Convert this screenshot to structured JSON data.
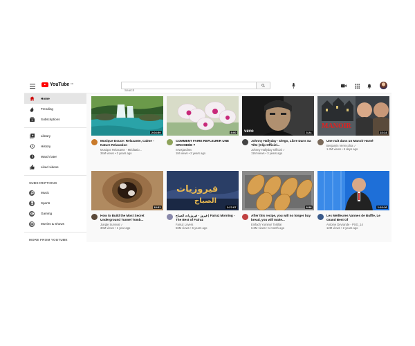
{
  "header": {
    "logo_text": "YouTube",
    "logo_region": "FR",
    "search_placeholder": "Search"
  },
  "sidebar": {
    "main": [
      {
        "label": "Home",
        "icon": "home-icon",
        "active": true
      },
      {
        "label": "Trending",
        "icon": "trending-icon"
      },
      {
        "label": "Subscriptions",
        "icon": "subscriptions-icon"
      }
    ],
    "library": [
      {
        "label": "Library",
        "icon": "library-icon"
      },
      {
        "label": "History",
        "icon": "history-icon"
      },
      {
        "label": "Watch later",
        "icon": "watch-later-icon"
      },
      {
        "label": "Liked videos",
        "icon": "like-icon"
      }
    ],
    "subscriptions_heading": "SUBSCRIPTIONS",
    "subscriptions": [
      {
        "label": "Music",
        "icon": "music-icon"
      },
      {
        "label": "Sports",
        "icon": "trophy-icon"
      },
      {
        "label": "Gaming",
        "icon": "gamepad-icon"
      },
      {
        "label": "Movies & Shows",
        "icon": "film-icon"
      }
    ],
    "more_heading": "MORE FROM YOUTUBE"
  },
  "videos": [
    {
      "title": "Musique Douce: Relaxante, Calme - Nature Relaxation",
      "channel": "Musique Relaxante - Méditatio...",
      "stats": "34M views • 3 years ago",
      "duration": "2:04:59",
      "thumb": "waterfall",
      "avatar": "#c97a2a"
    },
    {
      "title": "COMMENT FAIRE REFLEURIR UNE ORCHIDÉE ?",
      "channel": "newsjardintv",
      "stats": "1M views • 2 years ago",
      "duration": "8:00",
      "thumb": "orchid",
      "avatar": "#8ea35b"
    },
    {
      "title": "Johnny Hallyday - Diego, Libre Dans Sa Tête (Clip Officiel...",
      "channel": "Johnny Hallyday Official ✓",
      "stats": "11M views • 3 years ago",
      "duration": "3:24",
      "thumb": "johnny",
      "avatar": "#444444",
      "badge": "vevo"
    },
    {
      "title": "Une nuit dans un Manoir Hanté",
      "channel": "Benjamin Verrecchia ✓",
      "stats": "1.3M views • 5 days ago",
      "duration": "22:14",
      "thumb": "manor",
      "avatar": "#7a6a5a"
    },
    {
      "title": "How to Build the Most Secret Underground Tunnel Tomb...",
      "channel": "Jungle Survival ✓",
      "stats": "30M views • 1 year ago",
      "duration": "18:51",
      "thumb": "tunnel",
      "avatar": "#5b4a3a"
    },
    {
      "title": "فيروز - فيروزيات الصباح | Fairuz Morning - The Best of Fairuz",
      "channel": "Fairuz Lovers",
      "stats": "56M views • 6 years ago",
      "duration": "1:27:07",
      "thumb": "fairuz",
      "avatar": "#8888aa"
    },
    {
      "title": "After this recipe, you will no longer buy bread, you will make...",
      "channel": "Einfach Yummy! Tortilla!",
      "stats": "6.8M views • 1 month ago",
      "duration": "8:58",
      "thumb": "bread",
      "avatar": "#c04040"
    },
    {
      "title": "Les Meilleures Vannes de Buffle, Le Grand Best Of",
      "channel": "Antoine Dyvrande - PSG_14",
      "stats": "12M views • 2 years ago",
      "duration": "1:10:16",
      "thumb": "buffle",
      "avatar": "#3a5a8a"
    }
  ]
}
